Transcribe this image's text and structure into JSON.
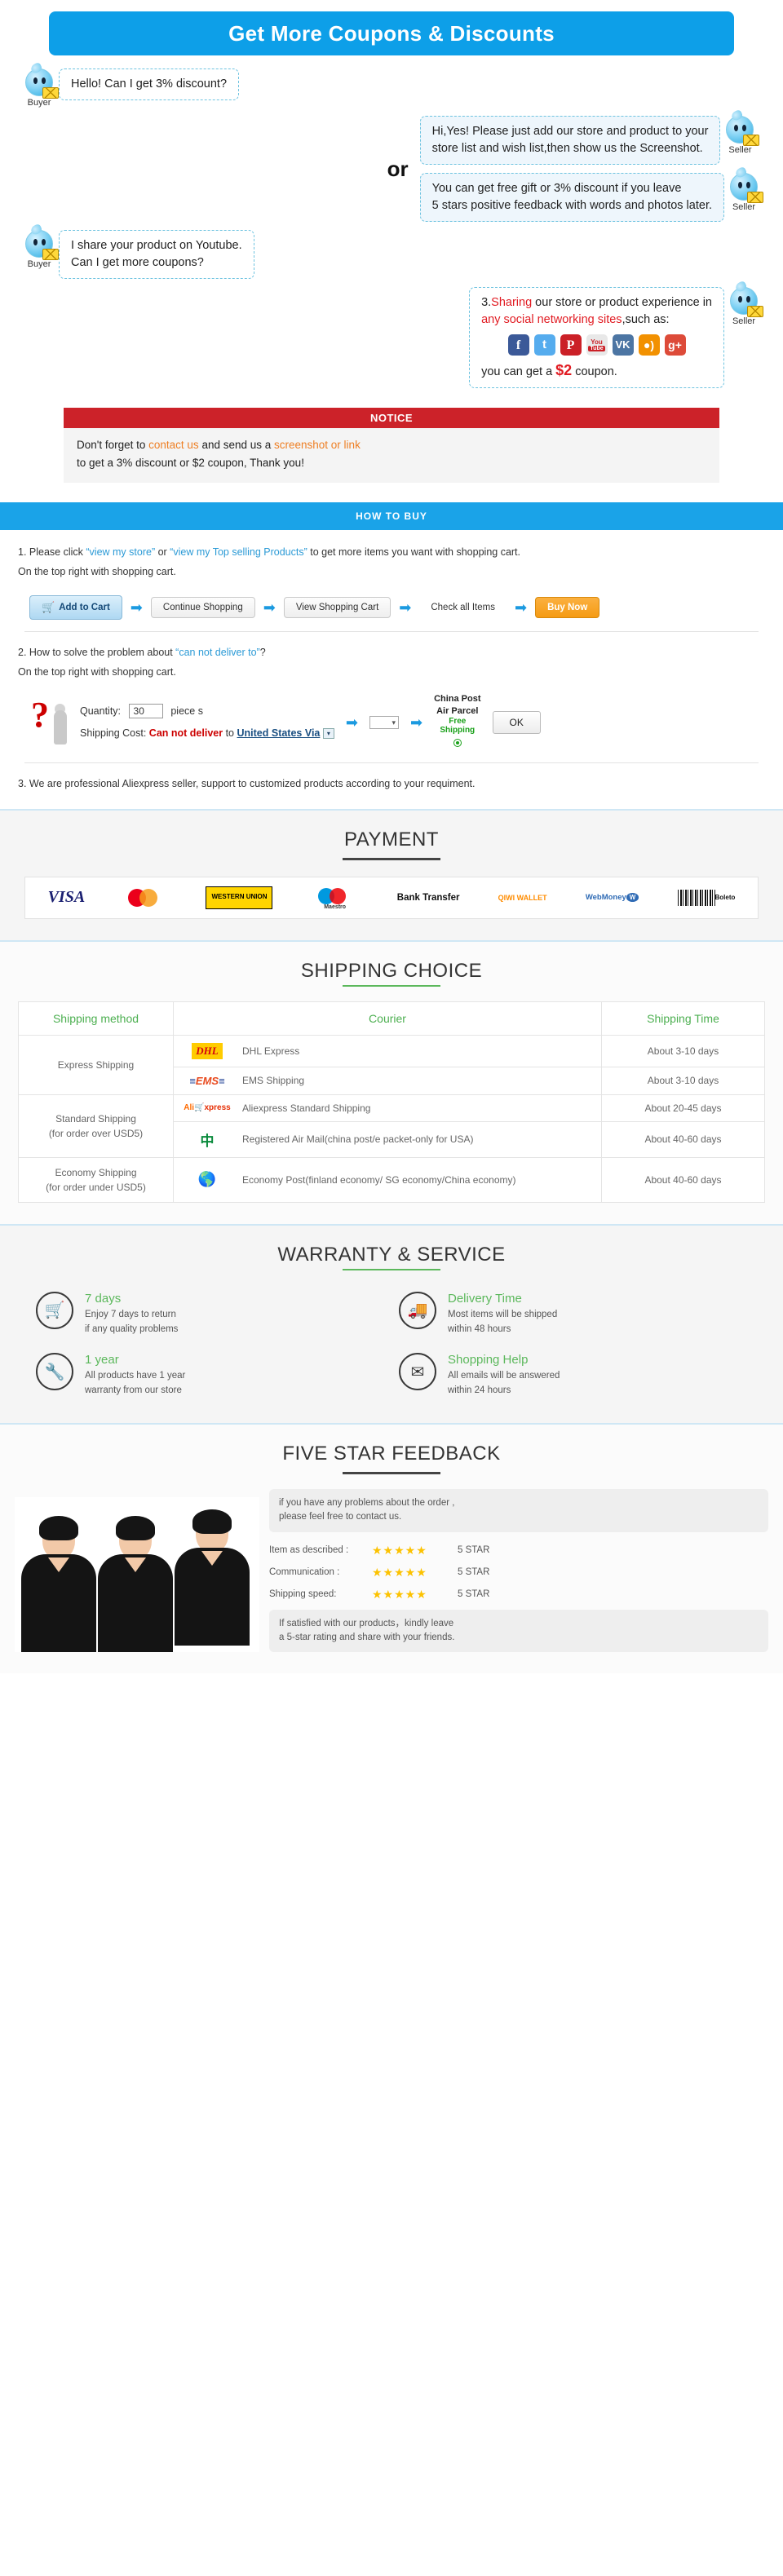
{
  "coupon": {
    "banner_title": "Get More Coupons & Discounts",
    "buyer_label": "Buyer",
    "seller_label": "Seller",
    "or_label": "or",
    "messages": [
      {
        "role": "buyer",
        "lines": [
          "Hello! Can I get 3% discount?"
        ]
      },
      {
        "role": "seller",
        "lines": [
          "Hi,Yes! Please just add our store and product to your",
          "store list and wish list,then show us the Screenshot."
        ]
      },
      {
        "role": "seller",
        "lines": [
          "You can get free gift or 3% discount if you leave",
          "5 stars positive feedback with words and photos later."
        ]
      },
      {
        "role": "buyer",
        "lines": [
          "I share your product on Youtube.",
          "Can I get more coupons?"
        ]
      }
    ],
    "share_bubble": {
      "line1_prefix": "3.",
      "line1_red": "Sharing",
      "line1_rest": " our store or product experience in",
      "line2_red": "any social networking sites",
      "line2_rest": ",such as:",
      "line3_prefix": "you can get a ",
      "line3_amount": "$2",
      "line3_suffix": " coupon.",
      "icons": [
        "facebook-icon",
        "twitter-icon",
        "pinterest-icon",
        "youtube-icon",
        "vk-icon",
        "rss-icon",
        "google-plus-icon"
      ]
    },
    "notice": {
      "heading": "NOTICE",
      "line1_a": "Don't forget to ",
      "line1_link": "contact us",
      "line1_b": " and send us a ",
      "line1_link2": "screenshot or link",
      "line2": "to get a 3% discount or $2 coupon, Thank you!"
    }
  },
  "howtobuy": {
    "bar_title": "HOW TO BUY",
    "step1": {
      "a": "1. Please click ",
      "link1": "“view my store”",
      "b": " or ",
      "link2": "“view my Top selling Products”",
      "c": " to get more items you want with shopping cart.",
      "second_line": "On the top right with shopping cart."
    },
    "buttons": {
      "add_to_cart": "Add to Cart",
      "continue_shopping": "Continue Shopping",
      "view_cart": "View Shopping Cart",
      "check_all": "Check all Items",
      "buy_now": "Buy Now"
    },
    "step2": {
      "a": "2. How to solve the problem about ",
      "link": "“can not deliver to”",
      "b": "?",
      "second_line": "On the top right with shopping cart.",
      "quantity_label": "Quantity:",
      "quantity_value": "30",
      "piece_label": "piece s",
      "shipping_label": "Shipping Cost:",
      "cannot_deliver": "Can not deliver",
      "to_label": "to",
      "country": "United States Via",
      "carrier_line1": "China Post",
      "carrier_line2": "Air Parcel",
      "free_ship_line1": "Free",
      "free_ship_line2": "Shipping",
      "ok_button": "OK"
    },
    "step3": "3. We are professional Aliexpress seller, support to customized products according to your requiment."
  },
  "payment": {
    "title": "PAYMENT",
    "methods": [
      {
        "name": "visa-logo",
        "label": "VISA"
      },
      {
        "name": "mastercard-logo",
        "label": "MasterCard"
      },
      {
        "name": "western-union-logo",
        "label": "WESTERN UNION"
      },
      {
        "name": "maestro-logo",
        "label": "Maestro"
      },
      {
        "name": "bank-transfer-logo",
        "label": "Bank Transfer"
      },
      {
        "name": "qiwi-wallet-logo",
        "label": "QIWI WALLET"
      },
      {
        "name": "webmoney-logo",
        "label": "WebMoney"
      },
      {
        "name": "boleto-logo",
        "label": "Boleto"
      }
    ]
  },
  "shipping": {
    "title": "SHIPPING CHOICE",
    "columns": [
      "Shipping method",
      "Courier",
      "Shipping Time"
    ],
    "rows": [
      {
        "method": "Express Shipping",
        "rowspan": 2,
        "courier_logo": "dhl-logo",
        "courier": "DHL Express",
        "time": "About 3-10 days"
      },
      {
        "method": "",
        "rowspan": 0,
        "courier_logo": "ems-logo",
        "courier": "EMS Shipping",
        "time": "About 3-10 days"
      },
      {
        "method": "Standard Shipping",
        "method2": "(for order over USD5)",
        "rowspan": 2,
        "courier_logo": "aliexpress-logo",
        "courier": "Aliexpress Standard Shipping",
        "time": "About 20-45 days"
      },
      {
        "method": "",
        "rowspan": 0,
        "courier_logo": "china-post-logo",
        "courier": "Registered Air Mail(china post/e packet-only for USA)",
        "time": "About 40-60 days"
      },
      {
        "method": "Economy Shipping",
        "method2": "(for order under USD5)",
        "rowspan": 1,
        "courier_logo": "un-logo",
        "courier": "Economy Post(finland economy/ SG economy/China economy)",
        "time": "About 40-60 days"
      }
    ]
  },
  "warranty": {
    "title": "WARRANTY & SERVICE",
    "items": [
      {
        "icon": "cart-circle-icon",
        "glyph": "🛒",
        "title": "7 days",
        "desc_line1": "Enjoy 7 days to return",
        "desc_line2": "if any quality problems"
      },
      {
        "icon": "truck-circle-icon",
        "glyph": "🚚",
        "title": "Delivery Time",
        "desc_line1": "Most items will be shipped",
        "desc_line2": "within 48 hours"
      },
      {
        "icon": "tools-circle-icon",
        "glyph": "🔧",
        "title": "1 year",
        "desc_line1": "All products have 1 year",
        "desc_line2": "warranty from our store"
      },
      {
        "icon": "envelope-circle-icon",
        "glyph": "✉",
        "title": "Shopping Help",
        "desc_line1": "All emails will be answered",
        "desc_line2": "within 24 hours"
      }
    ]
  },
  "feedback": {
    "title": "FIVE STAR FEEDBACK",
    "note_line1": "if you have any problems about the order ,",
    "note_line2": "please feel free to contact us.",
    "ratings": [
      {
        "label": "Item as described :",
        "stars": "★★★★★",
        "value": "5 STAR"
      },
      {
        "label": "Communication :",
        "stars": "★★★★★",
        "value": "5 STAR"
      },
      {
        "label": "Shipping speed:",
        "stars": "★★★★★",
        "value": "5 STAR"
      }
    ],
    "foot_line1": "If satisfied with our products，kindly leave",
    "foot_line2": "a 5-star rating and share with your friends."
  },
  "colors": {
    "blue": "#1aa3e8",
    "red": "#cc2229",
    "green": "#5cb85c",
    "orange": "#ee7f24"
  }
}
